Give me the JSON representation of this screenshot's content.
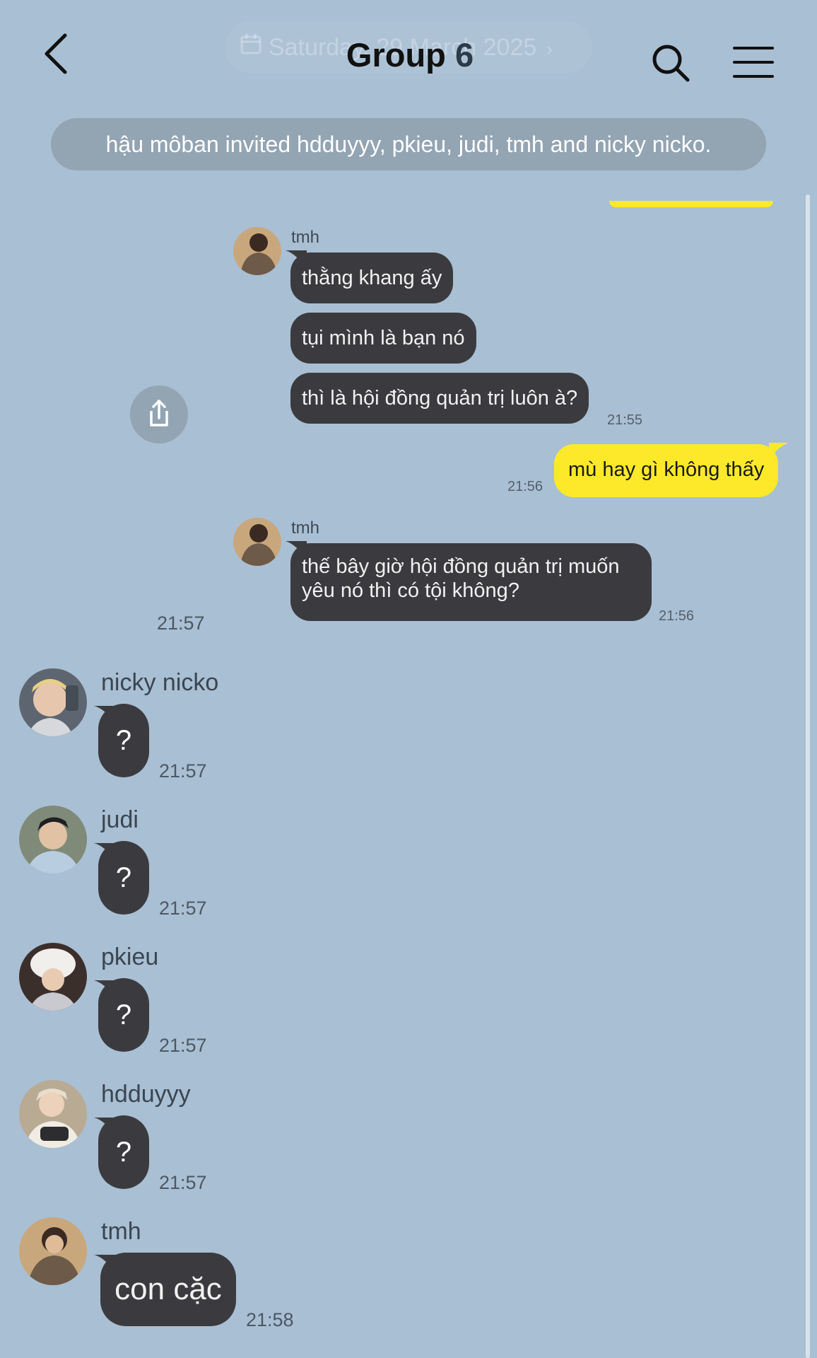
{
  "header": {
    "title": "Group",
    "member_count": "6",
    "date_pill": "Saturday, 29 March 2025"
  },
  "notice": "hậu môban invited hdduyyy, pkieu, judi, tmh and nicky nicko.",
  "messages": {
    "m1": {
      "sender": "tmh",
      "bubbles": [
        "thằng khang ấy",
        "tụi mình là bạn nó",
        "thì là hội đồng quản trị luôn à?"
      ],
      "time": "21:55"
    },
    "m2": {
      "text": "mù hay gì không thấy",
      "time": "21:56"
    },
    "m3": {
      "sender": "tmh",
      "line1": "thế bây giờ hội đồng quản trị muốn",
      "line2": "yêu nó thì có tội không?",
      "time": "21:56",
      "side_time": "21:57"
    },
    "m4": {
      "sender": "nicky nicko",
      "text": "?",
      "time": "21:57"
    },
    "m5": {
      "sender": "judi",
      "text": "?",
      "time": "21:57"
    },
    "m6": {
      "sender": "pkieu",
      "text": "?",
      "time": "21:57"
    },
    "m7": {
      "sender": "hdduyyy",
      "text": "?",
      "time": "21:57"
    },
    "m8": {
      "sender": "tmh",
      "text": "con cặc",
      "time": "21:58"
    }
  },
  "colors": {
    "background": "#a9bfd3",
    "my_bubble": "#fde92a",
    "their_bubble": "#3b3b3f"
  },
  "icons": [
    "back-arrow-icon",
    "calendar-icon",
    "search-icon",
    "menu-icon",
    "share-icon"
  ]
}
